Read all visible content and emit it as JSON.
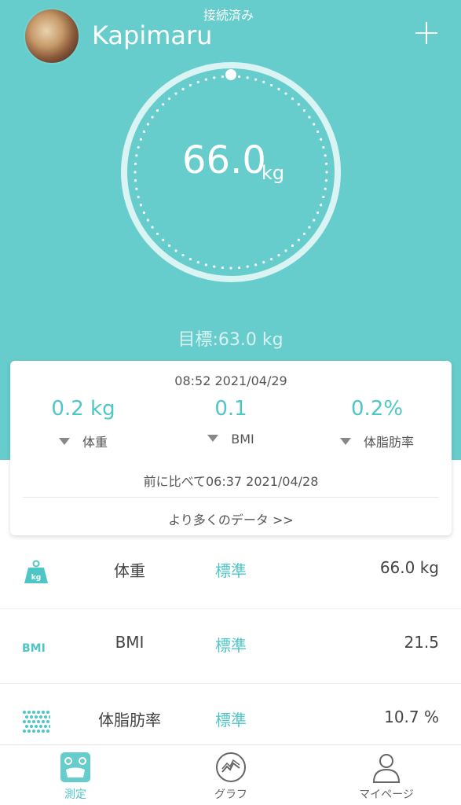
{
  "header": {
    "connection_status": "接続済み",
    "username": "Kapimaru"
  },
  "gauge": {
    "weight": "66.0",
    "unit": "kg",
    "goal": "目標:63.0 kg"
  },
  "summary_card": {
    "timestamp": "08:52 2021/04/29",
    "stats": [
      {
        "value": "0.2 kg",
        "label": "体重"
      },
      {
        "value": "0.1",
        "label": "BMI"
      },
      {
        "value": "0.2%",
        "label": "体脂肪率"
      }
    ],
    "compare_text": "前に比べて06:37 2021/04/28",
    "more_link": "より多くのデータ >>"
  },
  "metrics": [
    {
      "name": "体重",
      "status": "標準",
      "value": "66.0 kg",
      "icon": "weight-kg-icon"
    },
    {
      "name": "BMI",
      "status": "標準",
      "value": "21.5",
      "icon": "bmi-icon"
    },
    {
      "name": "体脂肪率",
      "status": "標準",
      "value": "10.7 %",
      "icon": "body-fat-dots-icon"
    }
  ],
  "tabs": [
    {
      "label": "測定",
      "icon": "scale-icon",
      "active": true
    },
    {
      "label": "グラフ",
      "icon": "graph-icon",
      "active": false
    },
    {
      "label": "マイページ",
      "icon": "person-icon",
      "active": false
    }
  ],
  "colors": {
    "accent": "#66cdcc",
    "accent_text": "#4fc6c6",
    "inactive": "#666666"
  }
}
